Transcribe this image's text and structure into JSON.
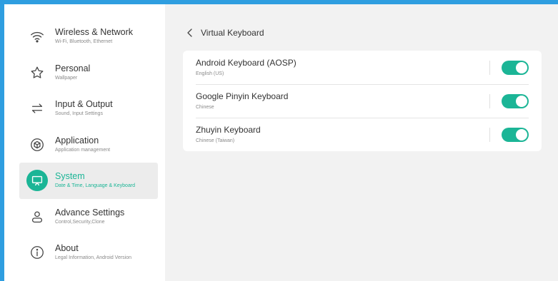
{
  "sidebar": {
    "items": [
      {
        "title": "Wireless & Network",
        "subtitle": "Wi-Fi, Bluetooth, Ethernet",
        "icon": "wifi-icon",
        "active": false
      },
      {
        "title": "Personal",
        "subtitle": "Wallpaper",
        "icon": "star-icon",
        "active": false
      },
      {
        "title": "Input & Output",
        "subtitle": "Sound, Input Settings",
        "icon": "swap-arrows-icon",
        "active": false
      },
      {
        "title": "Application",
        "subtitle": "Application management",
        "icon": "cube-icon",
        "active": false
      },
      {
        "title": "System",
        "subtitle": "Date & Time, Language & Keyboard",
        "icon": "monitor-icon",
        "active": true
      },
      {
        "title": "Advance Settings",
        "subtitle": "Control,Security,Clone",
        "icon": "person-icon",
        "active": false
      },
      {
        "title": "About",
        "subtitle": "Legal Information, Android Version",
        "icon": "info-icon",
        "active": false
      }
    ]
  },
  "header": {
    "title": "Virtual Keyboard"
  },
  "keyboards": [
    {
      "title": "Android Keyboard (AOSP)",
      "subtitle": "English (US)",
      "enabled": true
    },
    {
      "title": "Google Pinyin Keyboard",
      "subtitle": "Chinese",
      "enabled": true
    },
    {
      "title": "Zhuyin Keyboard",
      "subtitle": "Chinese (Taiwan)",
      "enabled": true
    }
  ],
  "colors": {
    "accent": "#1bb596",
    "window_border": "#2f9ee0",
    "active_bg": "#ececec"
  }
}
